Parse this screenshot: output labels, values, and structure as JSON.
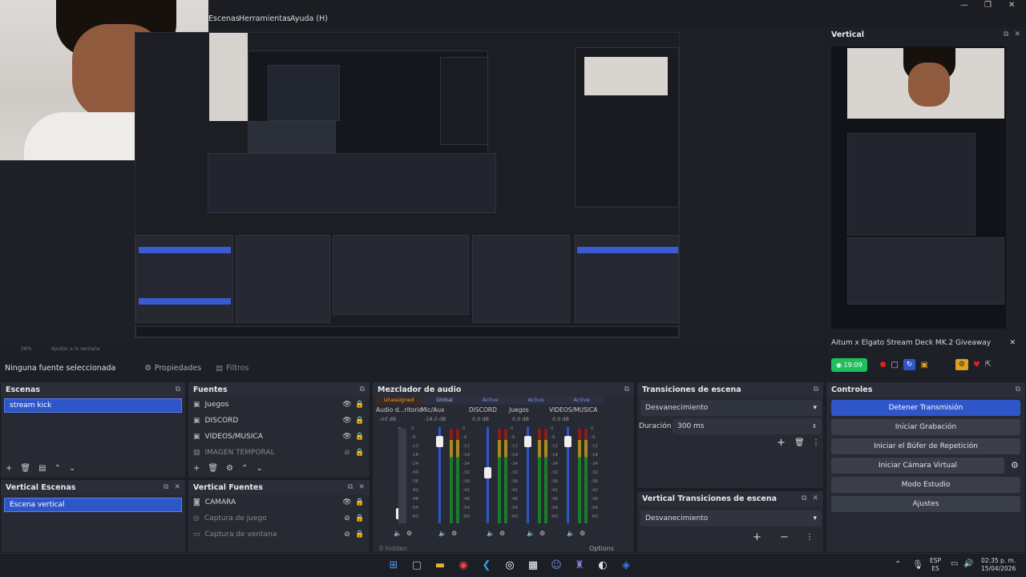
{
  "menu": {
    "items": [
      "Escenas",
      "Herramientas",
      "Ayuda (H)"
    ]
  },
  "window": {
    "min": "—",
    "max": "❐",
    "close": "✕"
  },
  "preview": {
    "zoom_label": "58%",
    "fit_label": "Ajustar a la ventana"
  },
  "status_bar": {
    "no_source": "Ninguna fuente seleccionada",
    "properties": "Propiedades",
    "filters": "Filtros"
  },
  "scenes": {
    "title": "Escenas",
    "items": [
      "stream kick"
    ]
  },
  "vertical_scenes": {
    "title": "Vertical Escenas",
    "items": [
      "Escena vertical"
    ]
  },
  "sources": {
    "title": "Fuentes",
    "items": [
      "Juegos",
      "DISCORD",
      "VIDEOS/MUSICA",
      "IMAGEN TEMPORAL"
    ]
  },
  "vertical_sources": {
    "title": "Vertical Fuentes",
    "items": [
      "CAMARA",
      "Captura de juego",
      "Captura de ventana"
    ]
  },
  "mixer": {
    "title": "Mezclador de audio",
    "tabs": [
      "Unassigned",
      "Global",
      "Active",
      "Active",
      "Active"
    ],
    "channels": [
      {
        "name": "Audio d...ritorio",
        "db": "-inf dB"
      },
      {
        "name": "Mic/Aux",
        "db": "-18.0 dB"
      },
      {
        "name": "DISCORD",
        "db": "0.0 dB"
      },
      {
        "name": "Juegos",
        "db": "0.0 dB"
      },
      {
        "name": "VIDEOS/MUSICA",
        "db": "0.0 dB"
      }
    ],
    "scale": [
      "0",
      "-6",
      "-12",
      "-18",
      "-24",
      "-30",
      "-36",
      "-42",
      "-48",
      "-54",
      "-60"
    ],
    "hidden_label": "0 hidden",
    "options_label": "Options"
  },
  "transitions": {
    "title": "Transiciones de escena",
    "selected": "Desvanecimiento",
    "duration_label": "Duración",
    "duration_value": "300 ms"
  },
  "vertical_transitions": {
    "title": "Vertical Transiciones de escena",
    "selected": "Desvanecimiento"
  },
  "controls": {
    "title": "Controles",
    "buttons": [
      "Detener Transmisión",
      "Iniciar Grabación",
      "Iniciar el Búfer de Repetición",
      "Iniciar Cámara Virtual",
      "Modo Estudio",
      "Ajustes"
    ]
  },
  "vertical_panel": {
    "title": "Vertical",
    "giveaway": "Aitum x Elgato Stream Deck MK.2 Giveaway",
    "live_time": "19:09"
  },
  "taskbar": {
    "lang_top": "ESP",
    "lang_bottom": "ES",
    "time": "02:35 p. m.",
    "date": "15/04/2026"
  },
  "colors": {
    "accent": "#2f56c9",
    "live": "#1fbf5c",
    "record": "#d22"
  }
}
